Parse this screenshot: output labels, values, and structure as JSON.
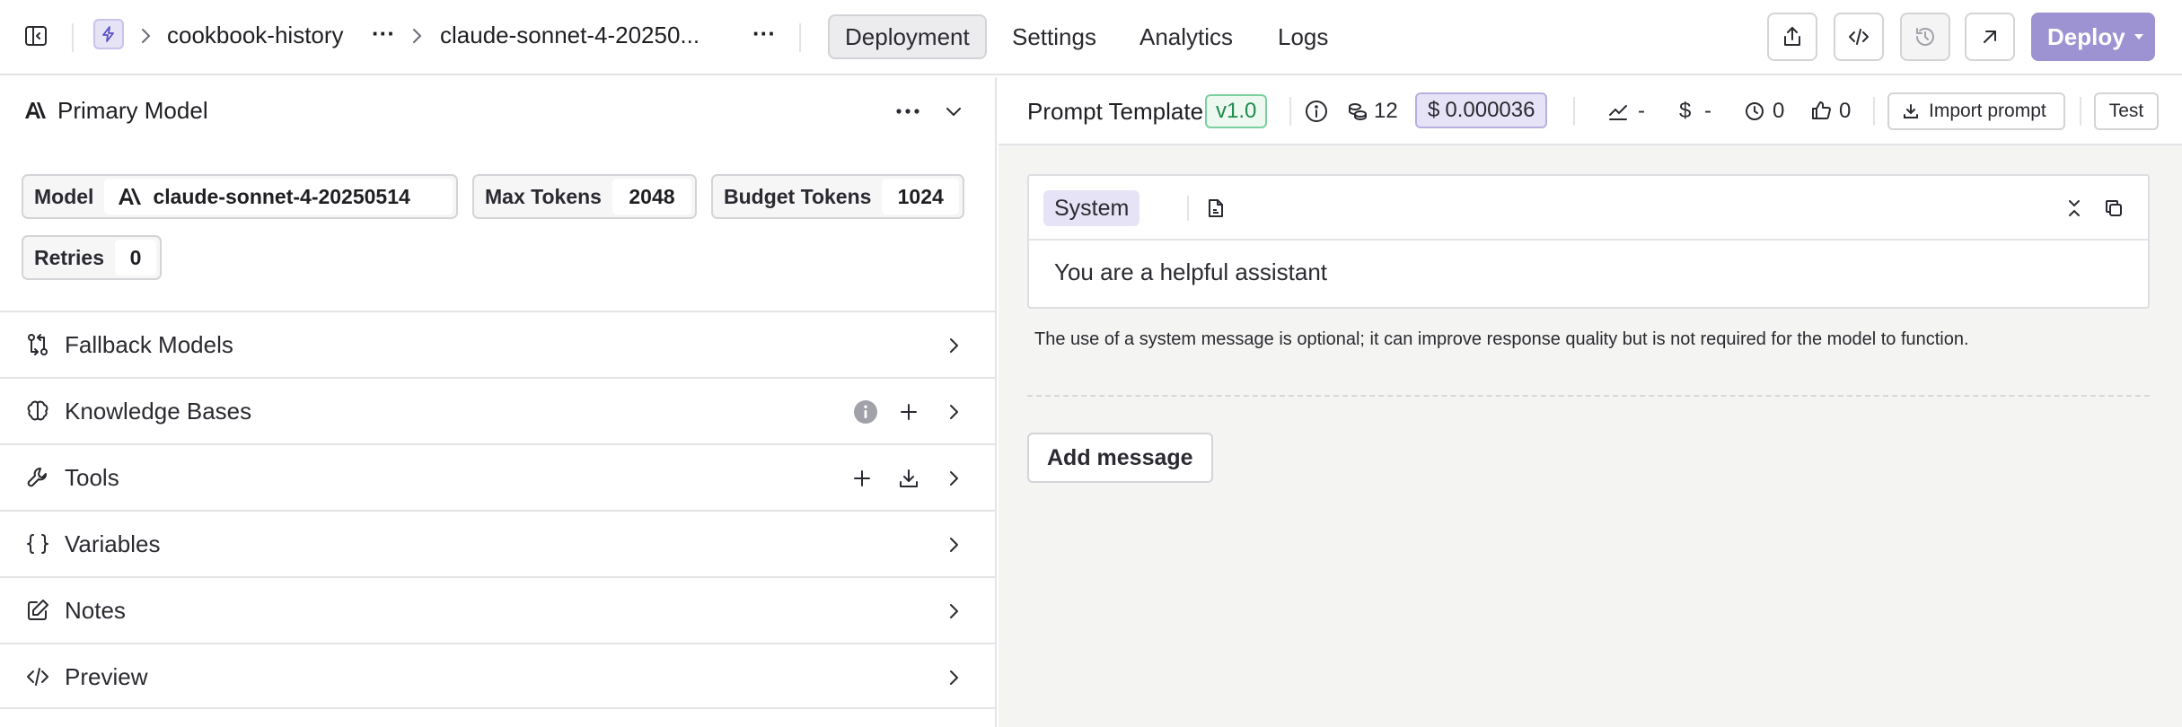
{
  "breadcrumb": {
    "project": "cookbook-history",
    "more1": "···",
    "prompt": "claude-sonnet-4-20250...",
    "more2": "···"
  },
  "nav_tabs": [
    {
      "label": "Deployment",
      "active": true
    },
    {
      "label": "Settings",
      "active": false
    },
    {
      "label": "Analytics",
      "active": false
    },
    {
      "label": "Logs",
      "active": false
    }
  ],
  "toolbar": {
    "deploy_label": "Deploy",
    "accent_color": "#9d92d2"
  },
  "primary_model": {
    "title": "Primary Model",
    "chips": [
      {
        "label": "Model",
        "value": "claude-sonnet-4-20250514"
      },
      {
        "label": "Max Tokens",
        "value": "2048"
      },
      {
        "label": "Budget Tokens",
        "value": "1024"
      },
      {
        "label": "Retries",
        "value": "0"
      }
    ]
  },
  "sections": [
    {
      "label": "Fallback Models",
      "icon": "fallback-icon"
    },
    {
      "label": "Knowledge Bases",
      "icon": "brain-icon"
    },
    {
      "label": "Tools",
      "icon": "wrench-icon"
    },
    {
      "label": "Variables",
      "icon": "braces-icon"
    },
    {
      "label": "Notes",
      "icon": "edit-icon"
    },
    {
      "label": "Preview",
      "icon": "code-icon"
    }
  ],
  "prompt_template": {
    "title": "Prompt Template",
    "version": "v1.0",
    "tokens": "12",
    "cost": "0.000036",
    "stat_trend": "-",
    "stat_cost": "-",
    "stat_latency": "0",
    "stat_likes": "0",
    "import_label": "Import prompt",
    "test_label": "Test"
  },
  "messages": [
    {
      "role": "System",
      "content": "You are a helpful assistant"
    }
  ],
  "system_note": "The use of a system message is optional; it can improve response quality but is not required for the model to function.",
  "add_message_label": "Add message"
}
